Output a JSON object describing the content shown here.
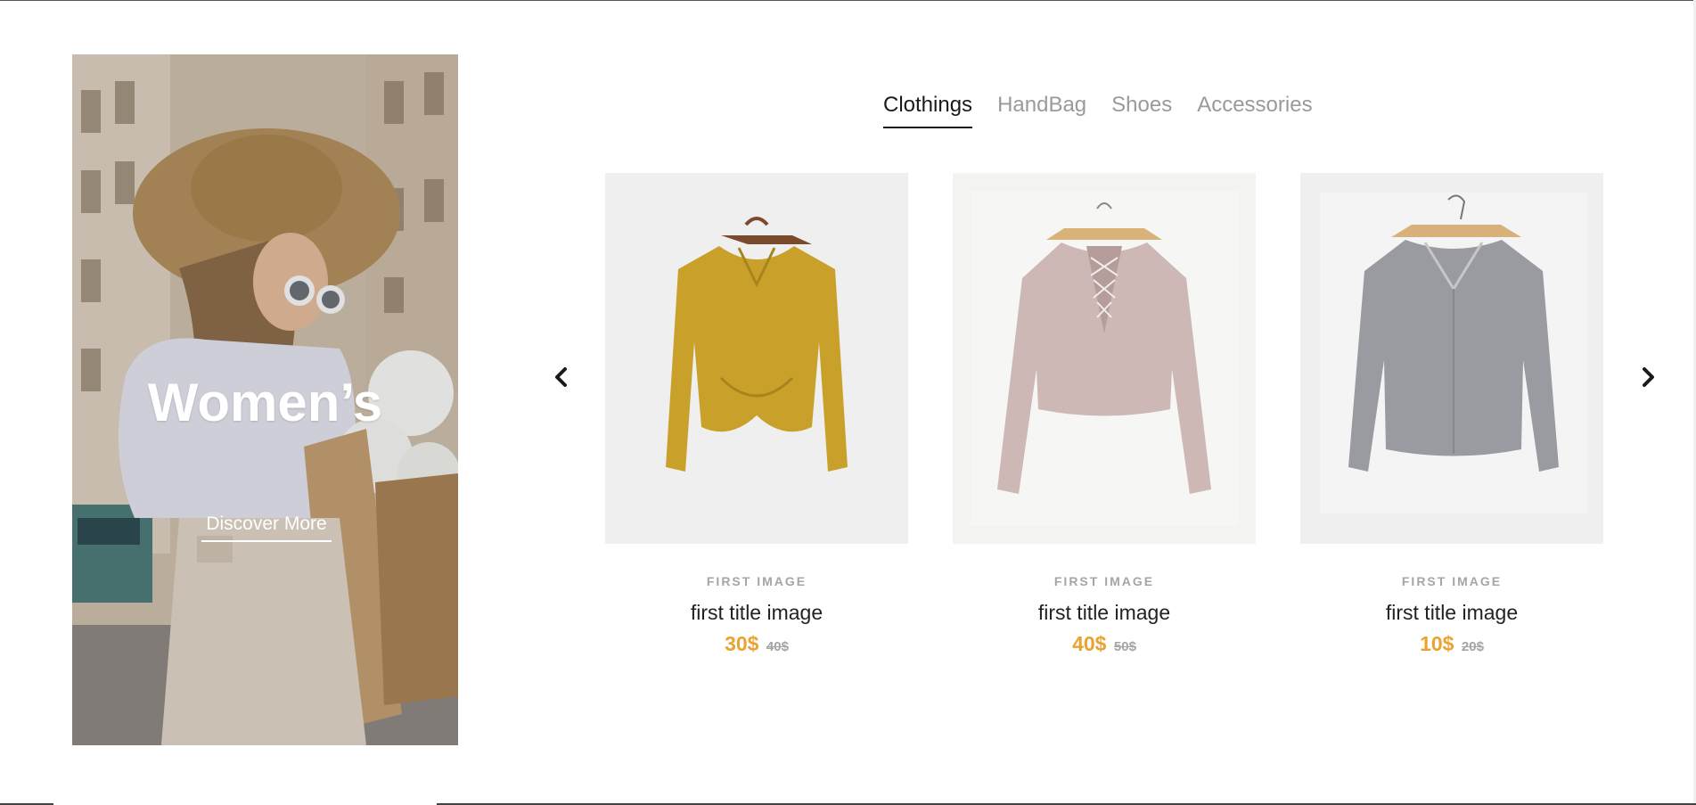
{
  "banner": {
    "title": "Women’s",
    "link_label": "Discover More"
  },
  "tabs": [
    {
      "label": "Clothings",
      "active": true
    },
    {
      "label": "HandBag",
      "active": false
    },
    {
      "label": "Shoes",
      "active": false
    },
    {
      "label": "Accessories",
      "active": false
    }
  ],
  "carousel": {
    "prev_icon": "chevron-left-icon",
    "next_icon": "chevron-right-icon"
  },
  "products": [
    {
      "category": "FIRST IMAGE",
      "title": "first title image",
      "price": "30$",
      "old_price": "40$",
      "color": "#c9a12a"
    },
    {
      "category": "FIRST IMAGE",
      "title": "first title image",
      "price": "40$",
      "old_price": "50$",
      "color": "#cdb8b6"
    },
    {
      "category": "FIRST IMAGE",
      "title": "first title image",
      "price": "10$",
      "old_price": "20$",
      "color": "#9a9ba0"
    }
  ],
  "colors": {
    "accent_price": "#e8a330",
    "tab_active": "#1a1a1a",
    "tab_inactive": "#9a9a9a"
  }
}
